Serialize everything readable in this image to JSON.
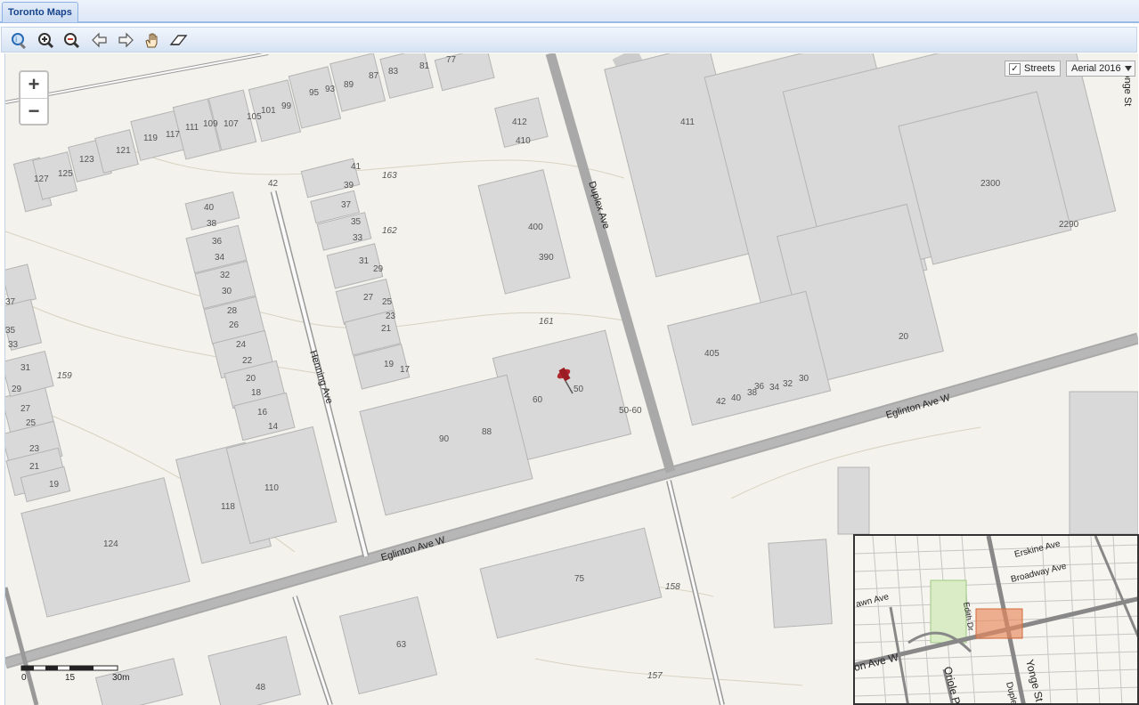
{
  "app": {
    "tab_title": "Toronto Maps"
  },
  "toolbar": {
    "tools": [
      {
        "name": "identify-icon"
      },
      {
        "name": "zoom-in-icon"
      },
      {
        "name": "zoom-out-icon"
      },
      {
        "name": "back-arrow-icon"
      },
      {
        "name": "forward-arrow-icon"
      },
      {
        "name": "pan-hand-icon"
      },
      {
        "name": "eraser-icon"
      }
    ]
  },
  "map": {
    "zoom_in_label": "+",
    "zoom_out_label": "−",
    "streets_toggle": {
      "label": "Streets",
      "checked": true
    },
    "basemap_select": {
      "value": "Aerial 2016"
    },
    "streets": [
      "Duplex Ave",
      "Henning Ave",
      "Eglinton Ave W",
      "Eglinton Ave W",
      "Yonge St"
    ],
    "contours": [
      "163",
      "162",
      "161",
      "159",
      "158",
      "157"
    ],
    "addresses": [
      "95",
      "93",
      "89",
      "87",
      "83",
      "81",
      "77",
      "119",
      "117",
      "111",
      "109",
      "107",
      "105",
      "101",
      "99",
      "412",
      "410",
      "411",
      "123",
      "121",
      "127",
      "125",
      "41",
      "39",
      "37",
      "35",
      "33",
      "31",
      "29",
      "27",
      "25",
      "23",
      "21",
      "19",
      "17",
      "42",
      "40",
      "38",
      "36",
      "34",
      "32",
      "30",
      "28",
      "26",
      "24",
      "22",
      "20",
      "18",
      "16",
      "14",
      "400",
      "390",
      "2300",
      "2290",
      "405",
      "20",
      "42",
      "40",
      "38",
      "36",
      "34",
      "32",
      "30",
      "60",
      "50",
      "50-60",
      "90",
      "88",
      "110",
      "118",
      "124",
      "75",
      "63",
      "48",
      "37",
      "35",
      "33",
      "31",
      "29",
      "27",
      "25",
      "23",
      "21",
      "19"
    ],
    "scale": {
      "labels": [
        "0",
        "15",
        "30m"
      ]
    }
  },
  "overview": {
    "labels": [
      "Erskine Ave",
      "Broadway Ave",
      "awn Ave",
      "Edith Dr",
      "on Ave W",
      "Oriole Pk",
      "Yonge St",
      "Duple"
    ]
  }
}
